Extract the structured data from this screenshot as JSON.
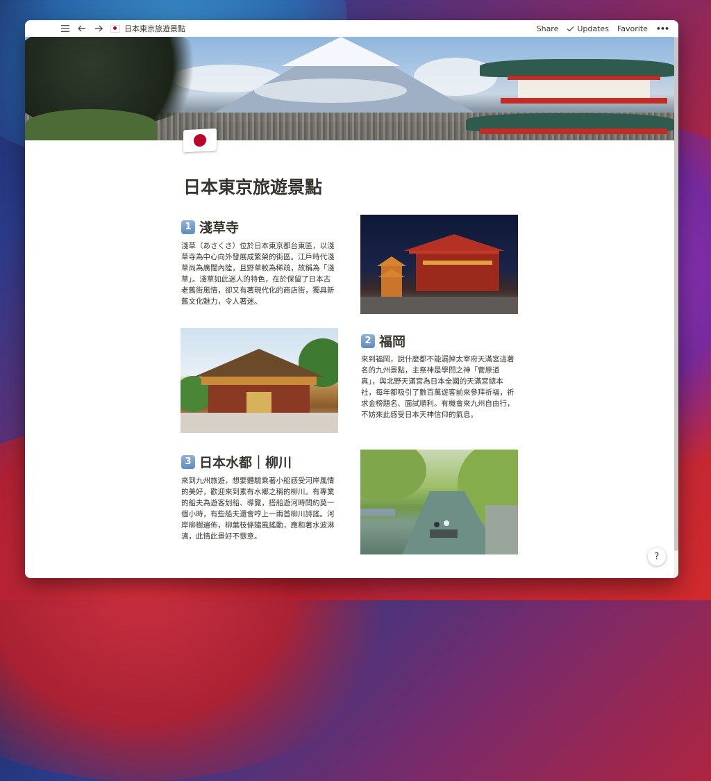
{
  "topbar": {
    "breadcrumb_title": "日本東京旅遊景點",
    "share_label": "Share",
    "updates_label": "Updates",
    "favorite_label": "Favorite",
    "more_label": "•••"
  },
  "page": {
    "icon": "japan-flag",
    "title": "日本東京旅遊景點"
  },
  "sections": [
    {
      "number": "1",
      "heading": "淺草寺",
      "body": "淺草（あさくさ）位於日本東京都台東區，以淺草寺為中心向外發展成繁榮的街區。江戶時代淺草尚為廣闊內陸，且野草較為稀疏，故稱為「淺草」。淺草如此迷人的特色，在於保留了日本古老舊街風情，卻又有著現代化的商店街，獨具新舊文化魅力，令人著迷。",
      "image": "sensoji-night-photo"
    },
    {
      "number": "2",
      "heading": "福岡",
      "body": "來到福岡，說什麼都不能漏掉太宰府天滿宮這著名的九州景點，主祭神是學問之神「菅原道真」，與北野天滿宮為日本全國的天滿宮總本社，每年都吸引了數百萬遊客前來參拜祈福，祈求金榜題名、面試順利。有機會來九州自由行，不妨來此感受日本天神信仰的氣息。",
      "image": "dazaifu-tenmangu-photo"
    },
    {
      "number": "3",
      "heading": "日本水都｜柳川",
      "body": "來到九州旅遊，想要體驗乘著小船感受河岸風情的美好，歡迎來到素有水鄉之稱的柳川。有專業的船夫為遊客划船、導覽，搭船遊河時間約莫一個小時，有些船夫還會哼上一兩首柳川詩謠。河岸柳樹遍佈，柳葉枝條隨風搖動，應和著水波淋漓，此情此景好不愜意。",
      "image": "yanagawa-canal-photo"
    }
  ],
  "help_label": "?"
}
